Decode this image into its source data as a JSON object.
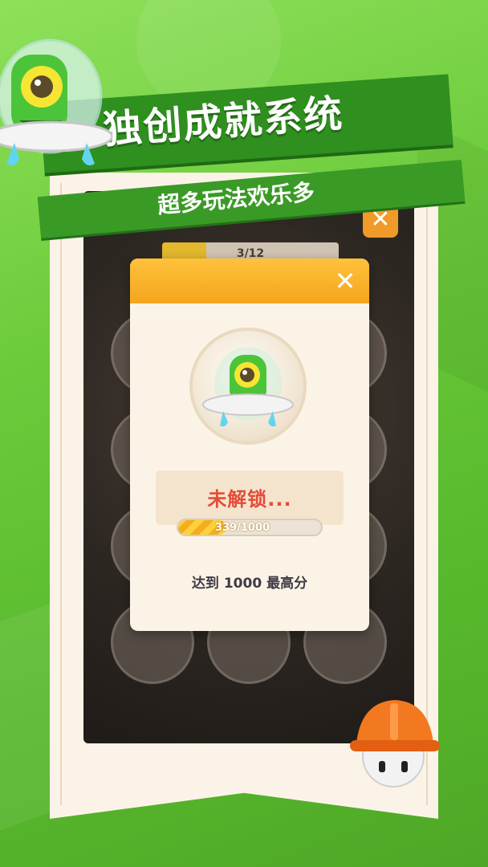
{
  "banner": {
    "title": "独创成就系统",
    "subtitle": "超多玩法欢乐多"
  },
  "game": {
    "progress_text": "3/12",
    "progress_fraction": 0.25,
    "close_icon": "close-icon"
  },
  "dialog": {
    "close_icon": "close-icon",
    "status": "未解锁...",
    "progress_text": "339/1000",
    "progress_value": 339,
    "progress_max": 1000,
    "goal_text": "达到 1000 最高分"
  },
  "colors": {
    "background": "#6ccb3b",
    "ribbon": "#2f8f1f",
    "dialog_header": "#f4a51e",
    "status_red": "#e24d3a",
    "paper": "#fbf3e7"
  }
}
